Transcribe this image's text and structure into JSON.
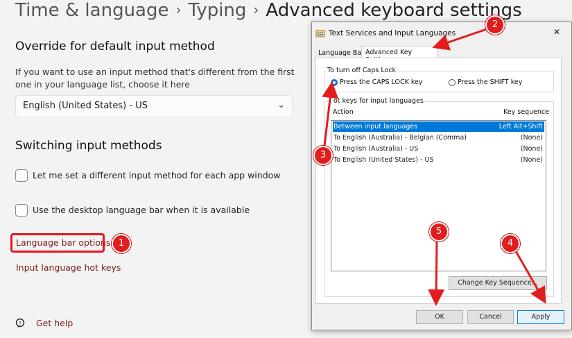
{
  "breadcrumb": {
    "items": [
      "Time & language",
      "Typing",
      "Advanced keyboard settings"
    ],
    "separator": "›"
  },
  "override": {
    "title": "Override for default input method",
    "description": "If you want to use an input method that's different from the first one in your language list, choose it here",
    "dropdown_value": "English (United States) - US"
  },
  "switching": {
    "title": "Switching input methods",
    "checkbox1": "Let me set a different input method for each app window",
    "checkbox2": "Use the desktop language bar when it is available",
    "language_bar_options": "Language bar options",
    "hot_keys": "Input language hot keys"
  },
  "help": {
    "label": "Get help"
  },
  "dialog": {
    "title": "Text Services and Input Languages",
    "close": "✕",
    "tabs": [
      "Language Bar",
      "Advanced Key Settings"
    ],
    "caps_group": "To turn off Caps Lock",
    "radio1": "Press the CAPS LOCK key",
    "radio2": "Press the SHIFT key",
    "hotkeys_group": "ot keys for input languages",
    "col_action": "Action",
    "col_seq": "Key sequence",
    "rows": [
      {
        "action": "Between input languages",
        "seq": "Left Alt+Shift"
      },
      {
        "action": "To English (Australia) - Belgian (Comma)",
        "seq": "(None)"
      },
      {
        "action": "To English (Australia) - US",
        "seq": "(None)"
      },
      {
        "action": "To English (United States) - US",
        "seq": "(None)"
      }
    ],
    "change_btn": "Change Key Sequence...",
    "ok": "OK",
    "cancel": "Cancel",
    "apply": "Apply"
  },
  "annotations": {
    "badges": [
      "1",
      "2",
      "3",
      "4",
      "5"
    ],
    "color": "#e11d1d"
  }
}
